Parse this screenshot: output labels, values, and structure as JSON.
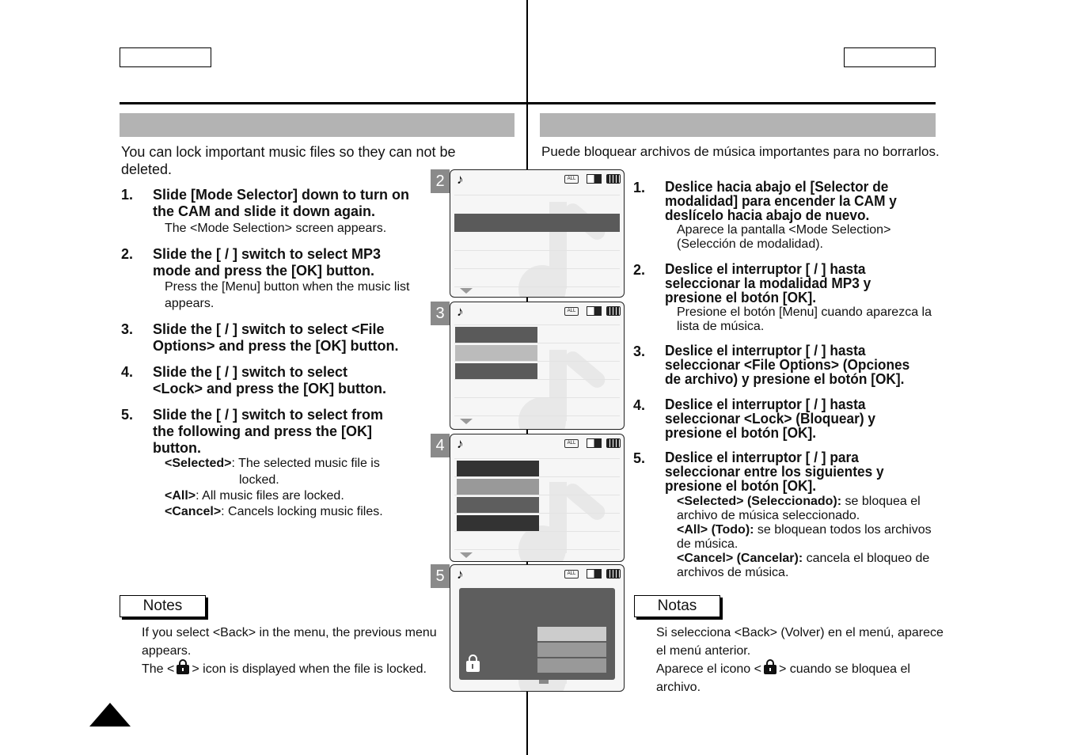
{
  "english": {
    "intro": "You can lock important music files so they can not be\ndeleted.",
    "steps": [
      {
        "num": "1.",
        "text": "Slide [Mode Selector] down to turn on\nthe CAM and slide it down again.",
        "sub": "The <Mode Selection> screen appears."
      },
      {
        "num": "2.",
        "text": "Slide the [     /     ] switch to select MP3\nmode and press the [OK] button.",
        "sub": "Press the [Menu] button when the music list\nappears."
      },
      {
        "num": "3.",
        "text": "Slide the [     /     ] switch to select <File\nOptions> and press the [OK] button."
      },
      {
        "num": "4.",
        "text": "Slide the [     /     ] switch to select\n<Lock> and press the [OK] button."
      },
      {
        "num": "5.",
        "text": "Slide the [     /     ] switch to select from\nthe following and press the [OK]\nbutton."
      }
    ],
    "options": [
      {
        "term": "<Selected>",
        "desc": ": The selected music file is",
        "desc2": "locked."
      },
      {
        "term": "<All>",
        "desc": ": All music files are locked."
      },
      {
        "term": "<Cancel>",
        "desc": ": Cancels locking music files."
      }
    ],
    "notes_label": "Notes",
    "notes": [
      "If you select <Back> in the menu, the previous menu appears.",
      {
        "before": "The <",
        "after": "> icon is displayed when the file is locked."
      }
    ]
  },
  "spanish": {
    "intro": "Puede bloquear archivos de música importantes para no borrarlos.",
    "steps": [
      {
        "num": "1.",
        "text": "Deslice hacia abajo el [Selector de\nmodalidad] para encender la CAM y\ndeslícelo hacia abajo de nuevo.",
        "sub": "Aparece la pantalla <Mode Selection>\n(Selección de modalidad)."
      },
      {
        "num": "2.",
        "text": "Deslice el interruptor [     /     ] hasta\nseleccionar la modalidad MP3 y\npresione el botón [OK].",
        "sub": "Presione el botón [Menu] cuando aparezca la\nlista de música."
      },
      {
        "num": "3.",
        "text": "Deslice el interruptor [     /     ] hasta\nseleccionar <File Options> (Opciones\nde archivo)  y presione el botón [OK]."
      },
      {
        "num": "4.",
        "text": "Deslice el interruptor [     /     ] hasta\nseleccionar <Lock> (Bloquear)  y\npresione el botón [OK]."
      },
      {
        "num": "5.",
        "text": "Deslice el interruptor [     /     ] para\nseleccionar entre los siguientes y\npresione el botón [OK]."
      }
    ],
    "options": [
      {
        "term": "<Selected> (Seleccionado):",
        "desc": " se bloquea el",
        "desc2": "archivo de música seleccionado."
      },
      {
        "term": "<All> (Todo):",
        "desc": " se bloquean todos los archivos",
        "desc2": "de música."
      },
      {
        "term": "<Cancel> (Cancelar):",
        "desc": " cancela el bloqueo de",
        "desc2": "archivos de música."
      }
    ],
    "notes_label": "Notas",
    "notes": [
      "Si selecciona <Back> (Volver) en el menú, aparece el menú anterior.",
      {
        "before": "Aparece el icono <",
        "after": "> cuando se bloquea el archivo."
      }
    ]
  },
  "screens": [
    {
      "step": "2",
      "icons": [
        "music-note",
        "repeat-all",
        "display-mode",
        "battery"
      ]
    },
    {
      "step": "3",
      "icons": [
        "music-note",
        "repeat-all",
        "display-mode",
        "battery"
      ]
    },
    {
      "step": "4",
      "icons": [
        "music-note",
        "repeat-all",
        "display-mode",
        "battery"
      ]
    },
    {
      "step": "5",
      "icons": [
        "music-note",
        "repeat-all",
        "display-mode",
        "battery",
        "lock"
      ]
    }
  ],
  "icon_text": {
    "all": "ALL",
    "n": "N",
    "note": "♪"
  },
  "colors": {
    "header_bar": "#b3b3b3",
    "badge": "#8a8a8a",
    "highlight_dark": "#5a5a5a",
    "highlight_light": "#bbbbbb"
  }
}
